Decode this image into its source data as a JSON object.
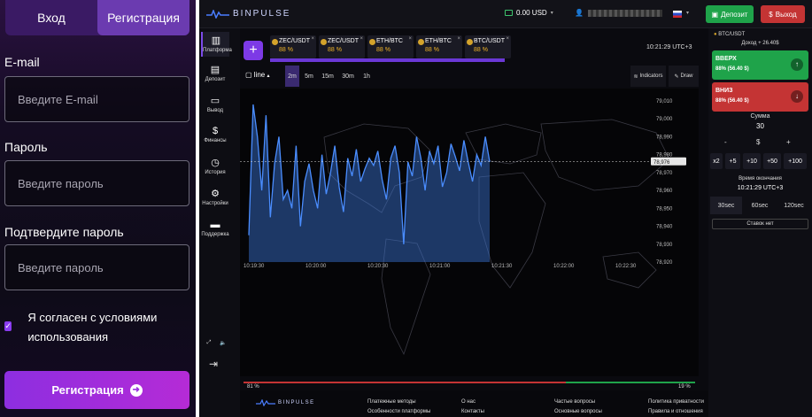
{
  "auth": {
    "tab_login": "Вход",
    "tab_register": "Регистрация",
    "email_label": "E-mail",
    "email_placeholder": "Введите E-mail",
    "password_label": "Пароль",
    "password_placeholder": "Введите пароль",
    "confirm_label": "Подтвердите пароль",
    "confirm_placeholder": "Введите пароль",
    "agree_text": "Я согласен с условиями использования",
    "register_button": "Регистрация"
  },
  "header": {
    "logo": "BINPULSE",
    "balance": "0.00 USD",
    "deposit": "Депозит",
    "exit": "Выход"
  },
  "sidebar": {
    "items": [
      {
        "label": "Платформа",
        "icon": "chart-icon"
      },
      {
        "label": "Депозит",
        "icon": "deposit-icon"
      },
      {
        "label": "Вывод",
        "icon": "withdraw-icon"
      },
      {
        "label": "Финансы",
        "icon": "dollar-icon"
      },
      {
        "label": "История",
        "icon": "clock-icon"
      },
      {
        "label": "Настройки",
        "icon": "gear-icon"
      },
      {
        "label": "Поддержка",
        "icon": "chat-icon"
      }
    ]
  },
  "assets": [
    {
      "name": "ZEC/USDT",
      "pct": "88 %"
    },
    {
      "name": "ZEC/USDT",
      "pct": "88 %"
    },
    {
      "name": "ETH/BTC",
      "pct": "88 %"
    },
    {
      "name": "ETH/BTC",
      "pct": "88 %"
    },
    {
      "name": "BTC/USDT",
      "pct": "88 %"
    }
  ],
  "server_time": "10:21:29 UTC+3",
  "chart_toolbar": {
    "type": "line",
    "timeframes": [
      "2m",
      "5m",
      "15m",
      "30m",
      "1h"
    ],
    "indicators": "Indicators",
    "draw": "Draw"
  },
  "chart_data": {
    "type": "area",
    "x_ticks": [
      "10:19:30",
      "10:20:00",
      "10:20:30",
      "10:21:00",
      "10:21:30",
      "10:22:00",
      "10:22:30"
    ],
    "y_ticks": [
      "79,010",
      "79,000",
      "78,990",
      "78,980",
      "78,970",
      "78,960",
      "78,950",
      "78,940",
      "78,930",
      "78,920"
    ],
    "ylim": [
      78920,
      79010
    ],
    "current_label": "78,976",
    "values": [
      78935,
      79008,
      78990,
      78960,
      79002,
      78945,
      78975,
      78990,
      78955,
      78960,
      78950,
      78985,
      78940,
      78965,
      78975,
      78960,
      78950,
      78980,
      78958,
      78970,
      78985,
      78962,
      78948,
      78978,
      78968,
      78983,
      78965,
      78972,
      78978,
      78974,
      78982,
      78966,
      78955,
      78978,
      78985,
      78970,
      78930,
      78976,
      78968,
      78990,
      78978,
      78960,
      78982,
      78975,
      78985,
      78962,
      78970,
      78986,
      78979,
      78971,
      78988,
      78976,
      78965,
      78980,
      78974,
      78990,
      78976
    ]
  },
  "sentiment": {
    "left": "81 %",
    "right": "19 %",
    "left_color": "#c43434",
    "right_color": "#1fa34a"
  },
  "footer": {
    "logo": "BINPULSE",
    "col1": [
      "Платежные методы",
      "Особенности платформы"
    ],
    "col2": [
      "О нас",
      "Контакты"
    ],
    "col3": [
      "Частые вопросы",
      "Основные вопросы"
    ],
    "col4": [
      "Политика приватности",
      "Правила и отношения"
    ]
  },
  "trade": {
    "asset": "BTC/USDT",
    "profit": "Доход + 26.40$",
    "up_label": "ВВЕРХ",
    "up_sub": "88% (56.40 $)",
    "down_label": "ВНИЗ",
    "down_sub": "88% (56.40 $)",
    "amount_label": "Сумма",
    "amount_value": "30",
    "minus": "-",
    "currency": "$",
    "plus": "+",
    "multipliers": [
      "x2",
      "+5",
      "+10",
      "+50",
      "+100"
    ],
    "expiry_label": "Время окончания",
    "expiry_value": "10:21:29 UTC+3",
    "durations": [
      "30sec",
      "60sec",
      "120sec"
    ],
    "cancel": "Ставок нет"
  }
}
